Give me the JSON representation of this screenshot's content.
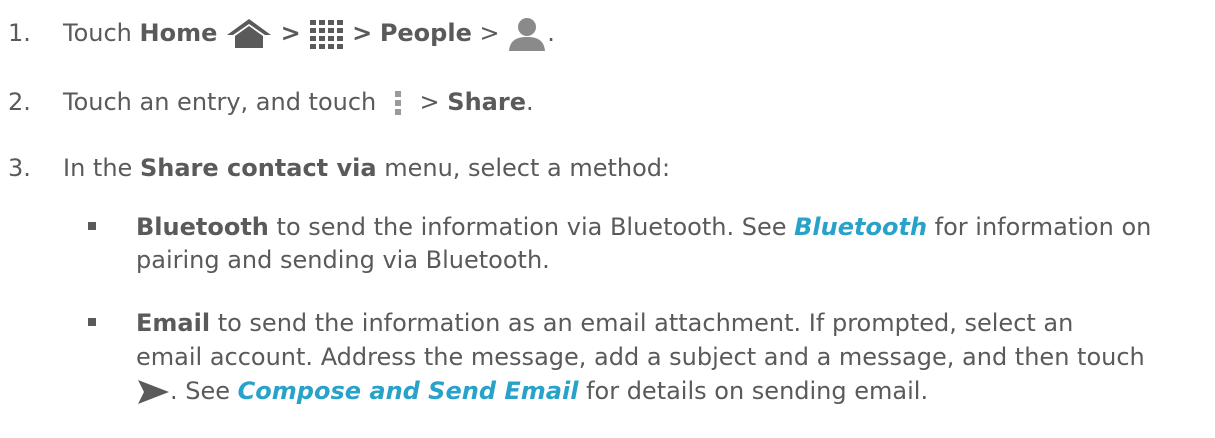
{
  "steps": [
    {
      "number": "1.",
      "touch": "Touch",
      "home": "Home",
      "sep1": ">",
      "sep2": ">",
      "people": "People",
      "sep3": ">",
      "end": "."
    },
    {
      "number": "2.",
      "text": "Touch an entry, and touch",
      "sep": ">",
      "share": "Share",
      "end": "."
    },
    {
      "number": "3.",
      "pre": "In the",
      "menu": "Share contact via",
      "post": "menu, select a method:"
    }
  ],
  "options": [
    {
      "name": "Bluetooth",
      "line1_text": "to send the information via Bluetooth. See",
      "link": "Bluetooth",
      "line1_tail": "for information on",
      "line2": "pairing and sending via Bluetooth."
    },
    {
      "name": "Email",
      "line1_text": "to send the information as an email attachment. If prompted, select an",
      "line2": "email account. Address the message, add a subject and a message, and then touch",
      "line3_pre": ". See",
      "link": "Compose and Send Email",
      "line3_post": "for details on sending email."
    }
  ],
  "icons": {
    "home": "home-icon",
    "apps": "apps-grid-icon",
    "contact": "person-icon",
    "menu": "menu-dots-icon",
    "send": "send-icon"
  },
  "colors": {
    "text": "#5a5a5a",
    "link": "#29a2c9"
  }
}
